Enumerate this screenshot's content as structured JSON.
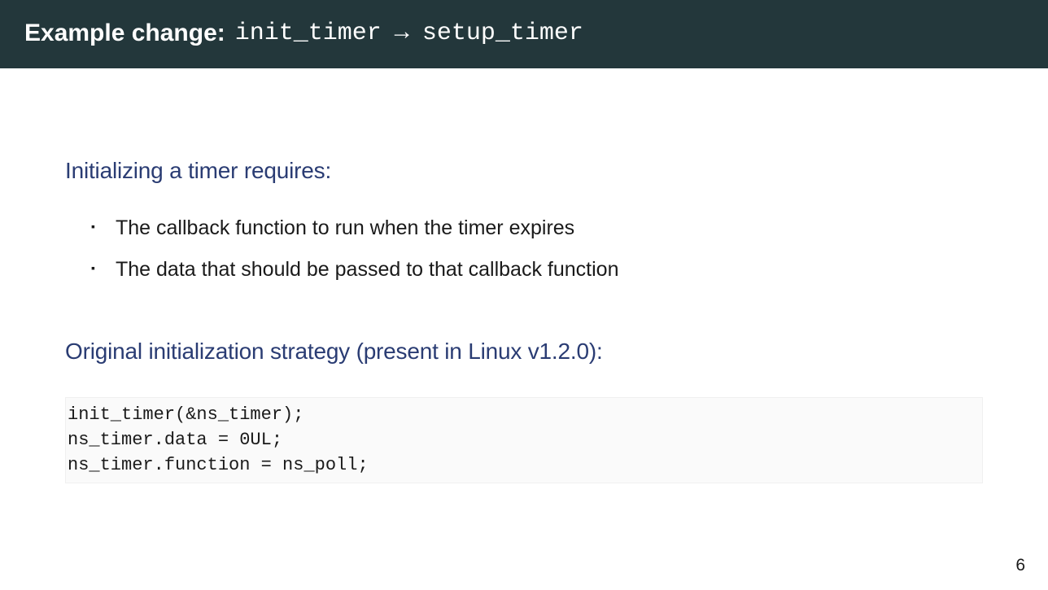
{
  "header": {
    "prefix": "Example change: ",
    "mono_from": "init_timer",
    "arrow": "→",
    "mono_to": "setup_timer"
  },
  "section1": {
    "title": "Initializing a timer requires:",
    "bullets": [
      "The callback function to run when the timer expires",
      "The data that should be passed to that callback function"
    ]
  },
  "section2": {
    "title": "Original initialization strategy (present in Linux v1.2.0):",
    "code": "init_timer(&ns_timer);\nns_timer.data = 0UL;\nns_timer.function = ns_poll;"
  },
  "page_number": "6"
}
